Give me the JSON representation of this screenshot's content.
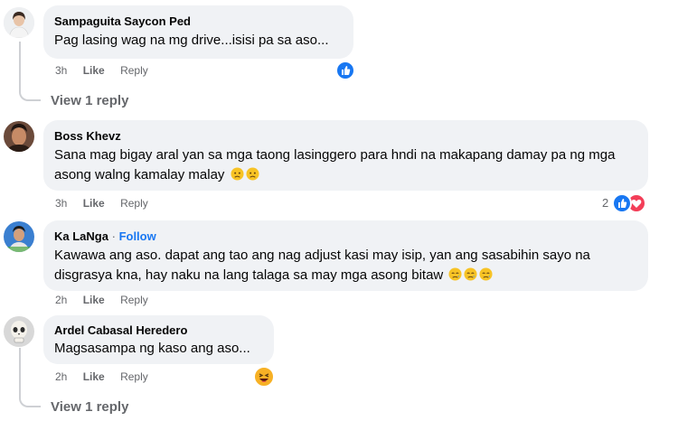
{
  "comments": [
    {
      "author": "Sampaguita Saycon Ped",
      "text": "Pag lasing wag na mg drive...isisi pa sa aso...",
      "time": "3h",
      "like_label": "Like",
      "reply_label": "Reply",
      "reactions": [
        "like"
      ],
      "view_replies": "View 1 reply"
    },
    {
      "author": "Boss Khevz",
      "text": "Sana mag bigay aral yan sa mga taong lasinggero para hndi na makapang damay pa ng mga asong walng kamalay malay",
      "time": "3h",
      "like_label": "Like",
      "reply_label": "Reply",
      "reactions": [
        "like",
        "love"
      ],
      "reaction_count": "2"
    },
    {
      "author": "Ka LaNga",
      "follow_separator": "·",
      "follow_label": "Follow",
      "text": "Kawawa ang aso. dapat ang tao ang nag adjust kasi may isip, yan ang sasabihin sayo na disgrasya kna, hay naku na lang talaga sa may mga asong bitaw",
      "time": "2h",
      "like_label": "Like",
      "reply_label": "Reply"
    },
    {
      "author": "Ardel Cabasal Heredero",
      "text": "Magsasampa ng kaso ang aso...",
      "time": "2h",
      "like_label": "Like",
      "reply_label": "Reply",
      "reactions": [
        "haha"
      ],
      "view_replies": "View 1 reply"
    }
  ],
  "colors": {
    "bubble": "#f0f2f5",
    "meta_text": "#65676b",
    "like_blue": "#1877f2",
    "love_red": "#f33e58",
    "haha_yellow": "#f7b125"
  }
}
